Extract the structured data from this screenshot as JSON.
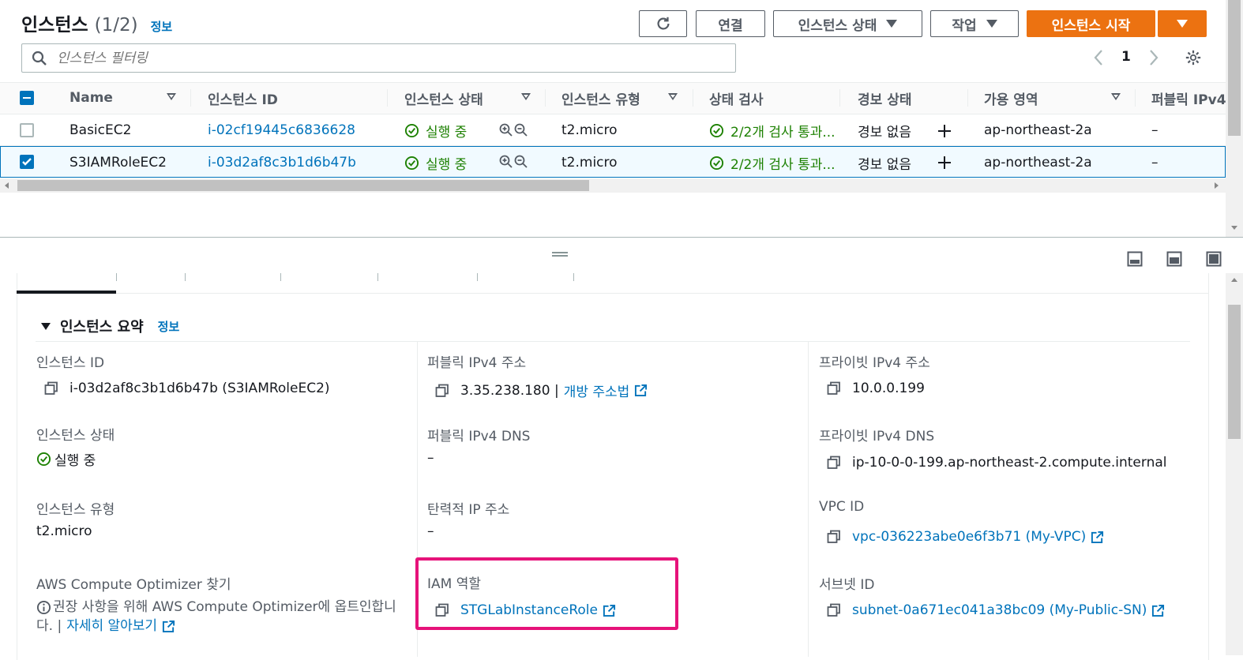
{
  "header": {
    "title": "인스턴스",
    "count": "(1/2)",
    "info_link": "정보",
    "connect_label": "연결",
    "state_label": "인스턴스 상태",
    "actions_label": "작업",
    "launch_label": "인스턴스 시작"
  },
  "search": {
    "placeholder": "인스턴스 필터링"
  },
  "pagination": {
    "page": "1"
  },
  "table": {
    "columns": [
      "Name",
      "인스턴스 ID",
      "인스턴스 상태",
      "인스턴스 유형",
      "상태 검사",
      "경보 상태",
      "가용 영역",
      "퍼블릭 IPv4"
    ],
    "rows": [
      {
        "name": "BasicEC2",
        "id": "i-02cf19445c6836628",
        "state": "실행 중",
        "type": "t2.micro",
        "check": "2/2개 검사 통과...",
        "alarm": "경보 없음",
        "az": "ap-northeast-2a",
        "ipv4": "–",
        "selected": false
      },
      {
        "name": "S3IAMRoleEC2",
        "id": "i-03d2af8c3b1d6b47b",
        "state": "실행 중",
        "type": "t2.micro",
        "check": "2/2개 검사 통과...",
        "alarm": "경보 없음",
        "az": "ap-northeast-2a",
        "ipv4": "–",
        "selected": true
      }
    ]
  },
  "summary": {
    "title": "인스턴스 요약",
    "info_link": "정보",
    "instance_id_label": "인스턴스 ID",
    "instance_id_value": "i-03d2af8c3b1d6b47b (S3IAMRoleEC2)",
    "public_ipv4_label": "퍼블릭 IPv4 주소",
    "public_ipv4_value": "3.35.238.180 |",
    "open_address_link": "개방 주소법",
    "private_ipv4_label": "프라이빗 IPv4 주소",
    "private_ipv4_value": "10.0.0.199",
    "instance_state_label": "인스턴스 상태",
    "instance_state_value": "실행 중",
    "public_dns_label": "퍼블릭 IPv4 DNS",
    "public_dns_value": "–",
    "private_dns_label": "프라이빗 IPv4 DNS",
    "private_dns_value": "ip-10-0-0-199.ap-northeast-2.compute.internal",
    "instance_type_label": "인스턴스 유형",
    "instance_type_value": "t2.micro",
    "elastic_ip_label": "탄력적 IP 주소",
    "elastic_ip_value": "–",
    "vpc_label": "VPC ID",
    "vpc_value": "vpc-036223abe0e6f3b71 (My-VPC)",
    "optimizer_label": "AWS Compute Optimizer 찾기",
    "optimizer_text_line1": "권장 사항을 위해 AWS Compute Optimizer에 옵트인합니",
    "optimizer_text_line2": "다. |",
    "optimizer_learn_more": "자세히 알아보기",
    "iam_label": "IAM 역할",
    "iam_value": "STGLabInstanceRole",
    "subnet_label": "서브넷 ID",
    "subnet_value": "subnet-0a671ec041a38bc09 (My-Public-SN)"
  },
  "colors": {
    "accent": "#0073bb",
    "orange": "#ec7211",
    "success": "#1d8102",
    "highlight": "#e6137a"
  }
}
